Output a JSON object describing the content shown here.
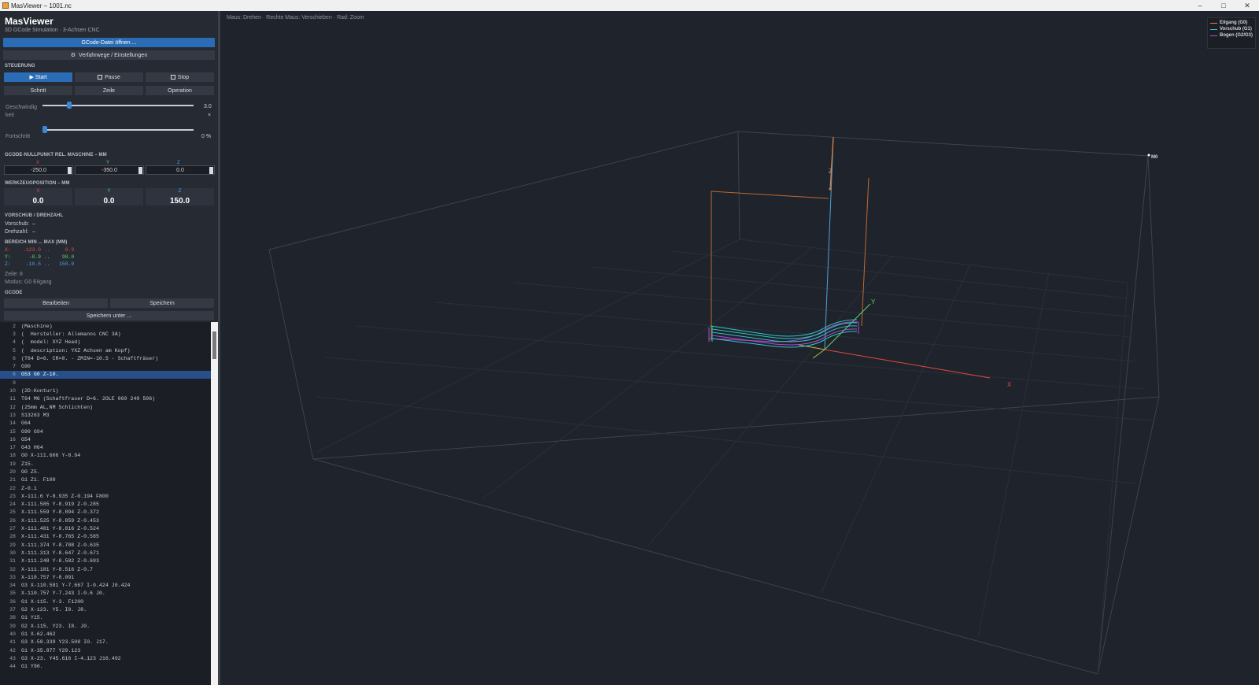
{
  "window": {
    "title": "MasViewer – 1001.nc",
    "minimize": "–",
    "maximize": "□",
    "close": "✕"
  },
  "app": {
    "title": "MasViewer",
    "subtitle": "3D GCode Simulation · 3-Achsen CNC"
  },
  "buttons": {
    "open_file": "GCode-Datei öffnen ...",
    "settings": "Verfahrwege / Einstellungen"
  },
  "control": {
    "section": "STEUERUNG",
    "start": "▶ Start",
    "pause": "Pause",
    "stop": "Stop",
    "step": "Schritt",
    "line": "Zeile",
    "operation": "Operation",
    "speed_label": "Geschwindigkeit",
    "speed_value": "3.0",
    "speed_unit": "×",
    "speed_fraction": 0.16,
    "progress_label": "Fortschritt",
    "progress_value": "0 %",
    "progress_fraction": 0.0
  },
  "origin": {
    "section": "GCODE-NULLPUNKT REL. MASCHINE – MM",
    "x_label": "X",
    "y_label": "Y",
    "z_label": "Z",
    "x": "-250.0",
    "y": "-350.0",
    "z": "0.0"
  },
  "tool_position": {
    "section": "WERKZEUGPOSITION – MM",
    "x_label": "X",
    "y_label": "Y",
    "z_label": "Z",
    "x": "0.0",
    "y": "0.0",
    "z": "150.0"
  },
  "feed": {
    "section": "VORSCHUB / DREHZAHL",
    "feed_label": "Vorschub:",
    "feed_value": "–",
    "speed_label": "Drehzahl:",
    "speed_value": "–"
  },
  "range": {
    "section": "BEREICH  MIN ... MAX (MM)",
    "x": "X:    -123.0 ..     0.9",
    "y": "Y:      -8.9 ..    98.0",
    "z": "Z:     -10.5 ..   150.0"
  },
  "status": {
    "line": "Zeile: 8",
    "mode": "Modus: G0 Eilgang"
  },
  "gcode": {
    "section": "GCODE",
    "edit": "Bearbeiten",
    "save": "Speichern",
    "save_as": "Speichern unter ...",
    "selected_index": 6,
    "lines": [
      {
        "n": "2",
        "t": "(Maschine)"
      },
      {
        "n": "3",
        "t": "(  Hersteller: Allemanns CNC 3A)"
      },
      {
        "n": "4",
        "t": "(  model: XYZ Head)"
      },
      {
        "n": "5",
        "t": "(  description: YXZ Achsen am Kopf)"
      },
      {
        "n": "6",
        "t": "(T64 D=6. CR=0. - ZMIN=-10.5 - Schaftfräser)"
      },
      {
        "n": "7",
        "t": "G90"
      },
      {
        "n": "8",
        "t": "G53 G0 Z-10."
      },
      {
        "n": "9",
        "t": ""
      },
      {
        "n": "10",
        "t": "(2D-Kontur1)"
      },
      {
        "n": "11",
        "t": "T64 M6 (Schaftfraser D=6. 2OLE 060 240 506)"
      },
      {
        "n": "12",
        "t": "(25mm AL,NM Schlichten)"
      },
      {
        "n": "13",
        "t": "S13263 M3"
      },
      {
        "n": "14",
        "t": "G64"
      },
      {
        "n": "15",
        "t": "G90 G94"
      },
      {
        "n": "16",
        "t": "G54"
      },
      {
        "n": "17",
        "t": "G43 H64"
      },
      {
        "n": "18",
        "t": "G0 X-111.606 Y-8.94"
      },
      {
        "n": "19",
        "t": "Z15."
      },
      {
        "n": "20",
        "t": "G0 Z5."
      },
      {
        "n": "21",
        "t": "G1 Z1. F100"
      },
      {
        "n": "22",
        "t": "Z-0.1"
      },
      {
        "n": "23",
        "t": "X-111.6 Y-8.935 Z-0.194 F800"
      },
      {
        "n": "24",
        "t": "X-111.585 Y-8.919 Z-0.285"
      },
      {
        "n": "25",
        "t": "X-111.559 Y-8.894 Z-0.372"
      },
      {
        "n": "26",
        "t": "X-111.525 Y-8.859 Z-0.453"
      },
      {
        "n": "27",
        "t": "X-111.481 Y-8.816 Z-0.524"
      },
      {
        "n": "28",
        "t": "X-111.431 Y-8.765 Z-0.585"
      },
      {
        "n": "29",
        "t": "X-111.374 Y-8.708 Z-0.635"
      },
      {
        "n": "30",
        "t": "X-111.313 Y-8.647 Z-0.671"
      },
      {
        "n": "31",
        "t": "X-111.248 Y-8.582 Z-0.693"
      },
      {
        "n": "32",
        "t": "X-111.181 Y-8.516 Z-0.7"
      },
      {
        "n": "33",
        "t": "X-110.757 Y-8.091"
      },
      {
        "n": "34",
        "t": "G3 X-110.581 Y-7.667 I-0.424 J0.424"
      },
      {
        "n": "35",
        "t": "X-110.757 Y-7.243 I-0.6 J0."
      },
      {
        "n": "36",
        "t": "G1 X-115. Y-3. F1200"
      },
      {
        "n": "37",
        "t": "G2 X-123. Y5. I0. J8."
      },
      {
        "n": "38",
        "t": "G1 Y15."
      },
      {
        "n": "39",
        "t": "G2 X-115. Y23. I8. J0."
      },
      {
        "n": "40",
        "t": "G1 X-62.462"
      },
      {
        "n": "41",
        "t": "G3 X-58.339 Y23.508 I0. J17."
      },
      {
        "n": "42",
        "t": "G1 X-35.877 Y29.123"
      },
      {
        "n": "43",
        "t": "G3 X-23. Y45.616 I-4.123 J16.492"
      },
      {
        "n": "44",
        "t": "G1 Y90."
      }
    ]
  },
  "viewport": {
    "hint": "Maus: Drehen · Rechte Maus: Verschieben · Rad: Zoom",
    "axis_x": "X",
    "axis_y": "Y",
    "axis_z": "Z",
    "machine_origin": "M0",
    "legend": [
      {
        "label": "Eilgang (G0)",
        "color": "#e0813a"
      },
      {
        "label": "Vorschub (G1)",
        "color": "#2ec4c4"
      },
      {
        "label": "Bogen (G2/G3)",
        "color": "#b04ad8"
      }
    ],
    "colors": {
      "x_axis": "#e04a3f",
      "y_axis": "#5fd36a",
      "z_axis": "#4aa3e0",
      "rapid": "#e0813a",
      "feed": "#2ec4c4",
      "arc": "#b04ad8",
      "grid": "#3a3f4a"
    }
  }
}
